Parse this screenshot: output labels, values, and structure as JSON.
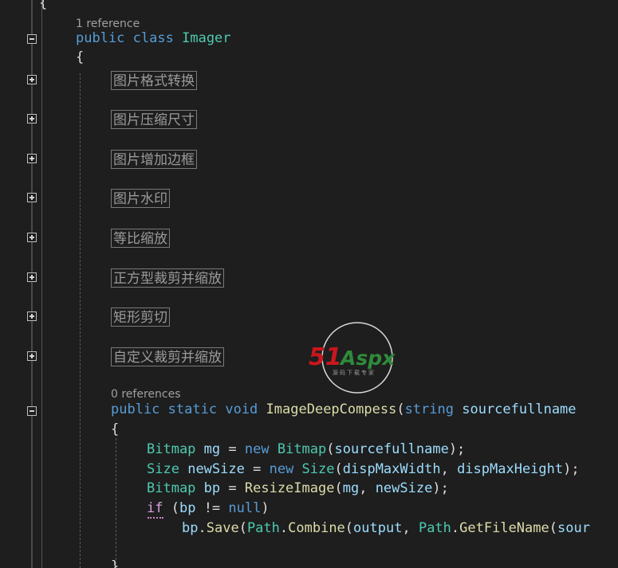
{
  "editor": {
    "top_brace": "{",
    "class": {
      "codelens": "1 reference",
      "kw_public": "public",
      "kw_class": "class",
      "name": "Imager",
      "open_brace": "{"
    },
    "regions": [
      "图片格式转换",
      "图片压缩尺寸",
      "图片增加边框",
      "图片水印",
      "等比缩放",
      "正方型裁剪并缩放",
      "矩形剪切",
      "自定义裁剪并缩放"
    ],
    "method": {
      "codelens": "0 references",
      "kw_public": "public",
      "kw_static": "static",
      "kw_void": "void",
      "name": "ImageDeepCompess",
      "paren": "(",
      "param_type": "string",
      "param_name": "sourcefullname",
      "open_brace": "{",
      "close_brace": "}"
    },
    "body": {
      "l1": {
        "type": "Bitmap",
        "var": "mg",
        "eq": " = ",
        "kw_new": "new",
        "ctor": "Bitmap",
        "open": "(",
        "arg": "sourcefullname",
        "close": ");"
      },
      "l2": {
        "type": "Size",
        "var": "newSize",
        "eq": " = ",
        "kw_new": "new",
        "ctor": "Size",
        "open": "(",
        "arg1": "dispMaxWidth",
        "comma": ", ",
        "arg2": "dispMaxHeight",
        "close": ");"
      },
      "l3": {
        "type": "Bitmap",
        "var": "bp",
        "eq": " = ",
        "fn": "ResizeImage",
        "open": "(",
        "arg1": "mg",
        "comma": ", ",
        "arg2": "newSize",
        "close": ");"
      },
      "l4": {
        "kw_if": "if",
        "open": " (",
        "var": "bp",
        "op": " != ",
        "kw_null": "null",
        "close": ")"
      },
      "l5": {
        "obj": "bp",
        "dot1": ".",
        "m1": "Save",
        "open1": "(",
        "cls1": "Path",
        "dot2": ".",
        "m2": "Combine",
        "open2": "(",
        "arg": "output",
        "comma": ", ",
        "cls2": "Path",
        "dot3": ".",
        "m3": "GetFileName",
        "open3": "(",
        "tail": "sour"
      }
    }
  },
  "watermark": {
    "brand_number": "51",
    "brand_text": "Aspx",
    "tagline": "源码下载专家"
  },
  "colors": {
    "background": "#1e1e1e",
    "keyword": "#569cd6",
    "type": "#4ec9b0",
    "method": "#dcdcaa",
    "parameter": "#9cdcfe",
    "control": "#d8a0df",
    "plain": "#dcdcdc",
    "codelens": "#a0a0a0",
    "collapsed_region": "#9b9b9b",
    "watermark_red": "#c8171d",
    "watermark_green": "#2e8b3a"
  }
}
